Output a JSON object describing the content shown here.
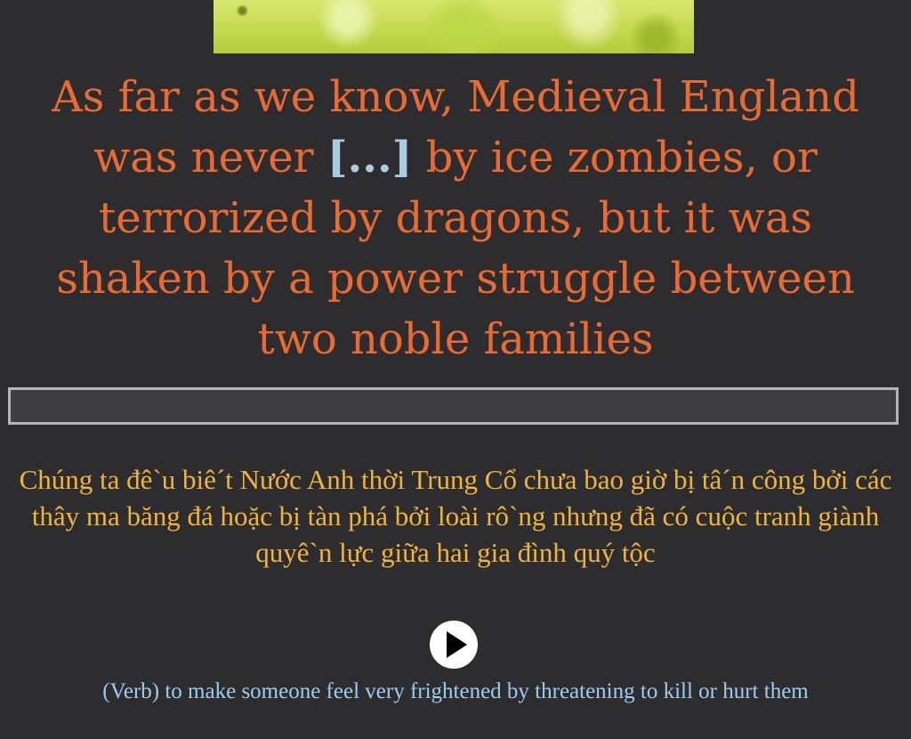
{
  "quote": {
    "before": "As far as we know, Medieval England was never ",
    "blank": "[...]",
    "after": " by ice zombies, or terrorized by dragons, but it was shaken by a power struggle between two noble families"
  },
  "answer_input": {
    "value": "",
    "placeholder": ""
  },
  "translation": {
    "text": "Chúng ta đê`u biê´t Nước Anh thời Trung Cổ chưa bao giờ bị tâ´n công bởi các thây ma băng đá hoặc bị tàn phá bởi loài rô`ng nhưng đã có cuộc tranh giành quyê`n lực giữa hai gia đình quý tộc"
  },
  "audio": {
    "icon": "play-icon"
  },
  "definition": {
    "text": "(Verb) to make someone feel very frightened by threatening to kill or hurt them"
  },
  "colors": {
    "background": "#2d2d2f",
    "quote": "#eb6a32",
    "blank": "#a8cce2",
    "translation": "#f0b43c",
    "definition": "#9ccdf0"
  }
}
